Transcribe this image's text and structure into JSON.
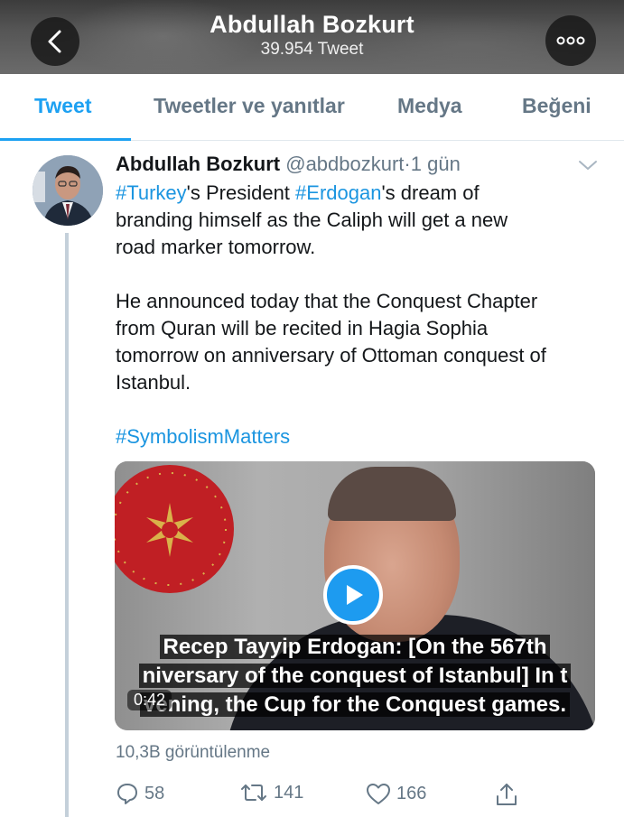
{
  "header": {
    "title": "Abdullah Bozkurt",
    "subtitle": "39.954 Tweet",
    "back_icon": "chevron-left-icon",
    "more_icon": "more-dots-icon"
  },
  "tabs": [
    {
      "label": "Tweet",
      "active": true
    },
    {
      "label": "Tweetler ve yanıtlar",
      "active": false
    },
    {
      "label": "Medya",
      "active": false
    },
    {
      "label": "Beğeni",
      "active": false
    }
  ],
  "tweet": {
    "author_name": "Abdullah Bozkurt",
    "handle": "@abdbozkurt",
    "separator": "·",
    "time": "1 gün",
    "line1_tag1": "#Turkey",
    "line1_mid": "'s President ",
    "line1_tag2": "#Erdogan",
    "line1_end": "'s dream of",
    "line2": "branding himself as the Caliph will get a new",
    "line3": "road marker tomorrow.",
    "para2_line1": "He announced today that the Conquest Chapter",
    "para2_line2": "from Quran will be recited in Hagia Sophia",
    "para2_line3": "tomorrow on anniversary of Ottoman conquest of",
    "para2_line4": "Istanbul.",
    "hashtag_footer": "#SymbolismMatters",
    "video": {
      "caption_line1": "Recep Tayyip Erdogan: [On the 567th",
      "caption_line2": "niversary of the conquest of Istanbul] In t",
      "caption_line3": "vening, the Cup for the Conquest games.",
      "duration": "0:42"
    },
    "views": "10,3B görüntülenme",
    "actions": {
      "replies": "58",
      "retweets": "141",
      "likes": "166"
    }
  },
  "colors": {
    "accent": "#1da1f2",
    "hashtag": "#1b95e0",
    "muted": "#657786"
  }
}
